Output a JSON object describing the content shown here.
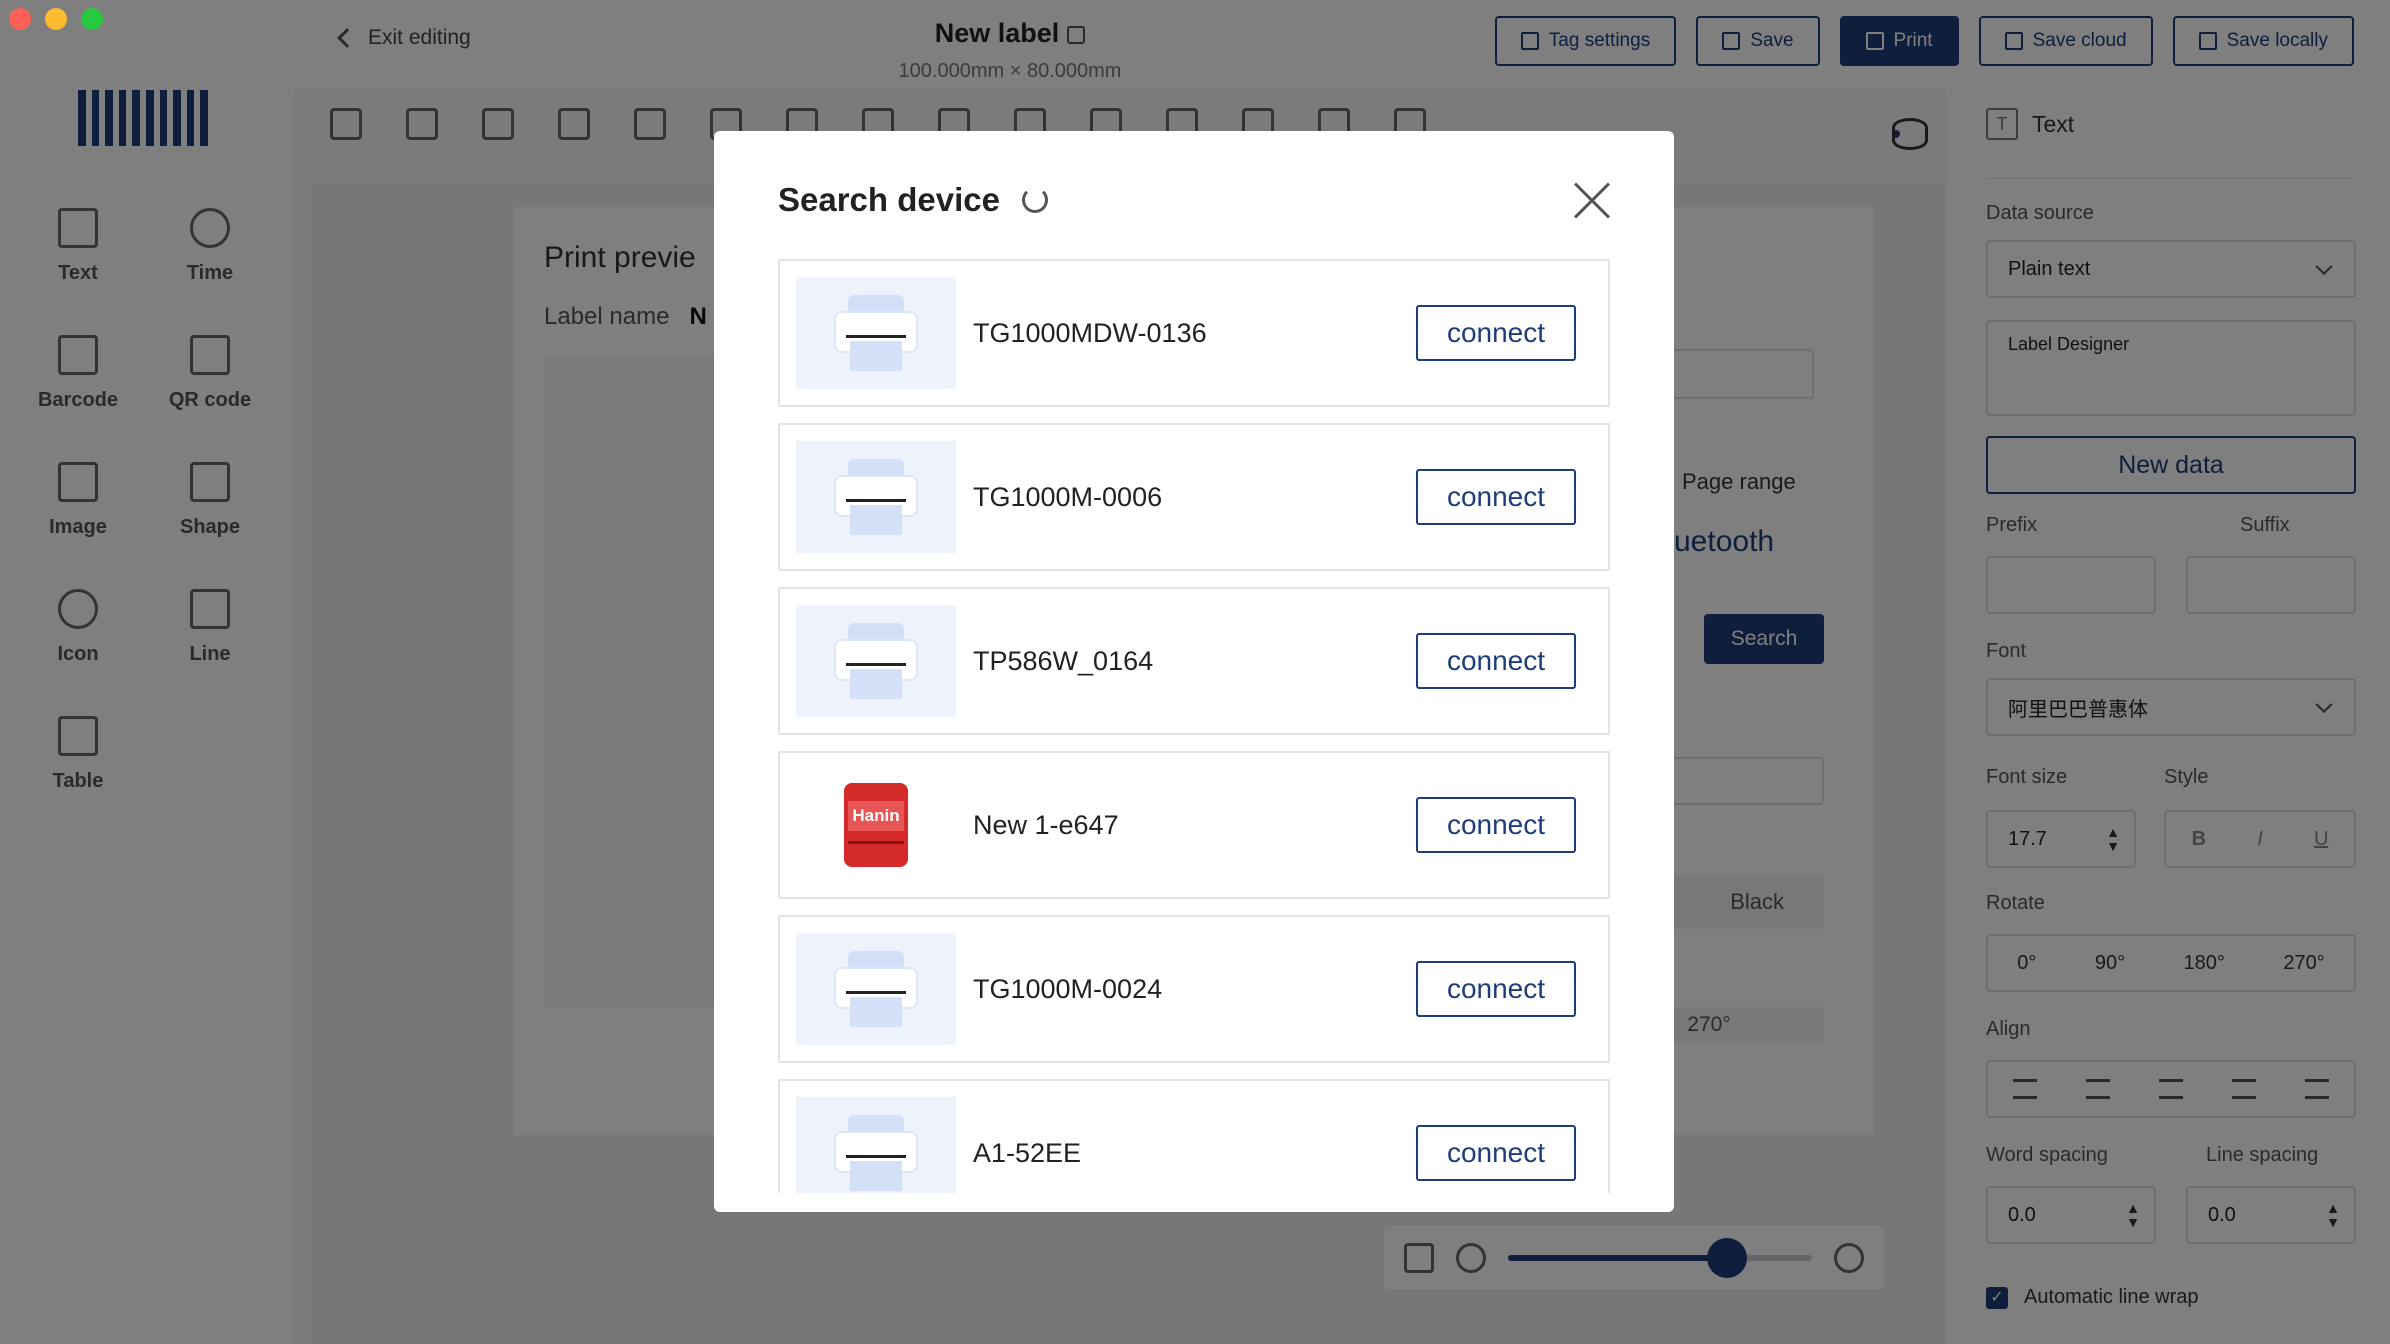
{
  "header": {
    "exit_label": "Exit editing",
    "title": "New label",
    "size": "100.000mm × 80.000mm",
    "buttons": {
      "tag_settings": "Tag settings",
      "save": "Save",
      "print": "Print",
      "save_cloud": "Save cloud",
      "save_locally": "Save locally"
    }
  },
  "sidebar": {
    "tools": [
      {
        "label": "Text",
        "icon": "text-icon"
      },
      {
        "label": "Time",
        "icon": "clock-icon"
      },
      {
        "label": "Barcode",
        "icon": "barcode-icon"
      },
      {
        "label": "QR code",
        "icon": "qr-code-icon"
      },
      {
        "label": "Image",
        "icon": "image-icon"
      },
      {
        "label": "Shape",
        "icon": "square-icon"
      },
      {
        "label": "Icon",
        "icon": "icon-grid-icon"
      },
      {
        "label": "Line",
        "icon": "line-icon"
      },
      {
        "label": "Table",
        "icon": "table-icon"
      }
    ]
  },
  "print_preview": {
    "title": "Print previe",
    "label_name": "Label name",
    "label_name_value": "N",
    "page_range": "Page range",
    "bluetooth": "uetooth",
    "search": "Search",
    "color": "Black",
    "rotate_label": "270°"
  },
  "right_panel": {
    "section": "Text",
    "data_source_label": "Data source",
    "data_source_value": "Plain text",
    "text_content": "Label Designer",
    "new_data": "New data",
    "prefix_label": "Prefix",
    "suffix_label": "Suffix",
    "font_label": "Font",
    "font_value": "阿里巴巴普惠体",
    "font_size_label": "Font size",
    "font_size_value": "17.7",
    "style_label": "Style",
    "style_bold": "B",
    "style_italic": "I",
    "style_underline": "U",
    "rotate_label": "Rotate",
    "rotate_options": [
      "0°",
      "90°",
      "180°",
      "270°"
    ],
    "align_label": "Align",
    "word_spacing_label": "Word spacing",
    "word_spacing_value": "0.0",
    "line_spacing_label": "Line spacing",
    "line_spacing_value": "0.0",
    "auto_wrap_label": "Automatic line wrap",
    "auto_wrap_checked": true
  },
  "zoom": {
    "level": 0.72
  },
  "modal": {
    "title": "Search device",
    "connect_label": "connect",
    "devices": [
      {
        "name": "TG1000MDW-0136",
        "type": "printer"
      },
      {
        "name": "TG1000M-0006",
        "type": "printer"
      },
      {
        "name": "TP586W_0164",
        "type": "printer"
      },
      {
        "name": "New 1-e647",
        "type": "red-printer",
        "brand": "Hanin"
      },
      {
        "name": "TG1000M-0024",
        "type": "printer"
      },
      {
        "name": "A1-52EE",
        "type": "printer"
      }
    ]
  },
  "colors": {
    "accent": "#1f3d7a",
    "overlay": "rgba(0,0,0,0.5)"
  }
}
